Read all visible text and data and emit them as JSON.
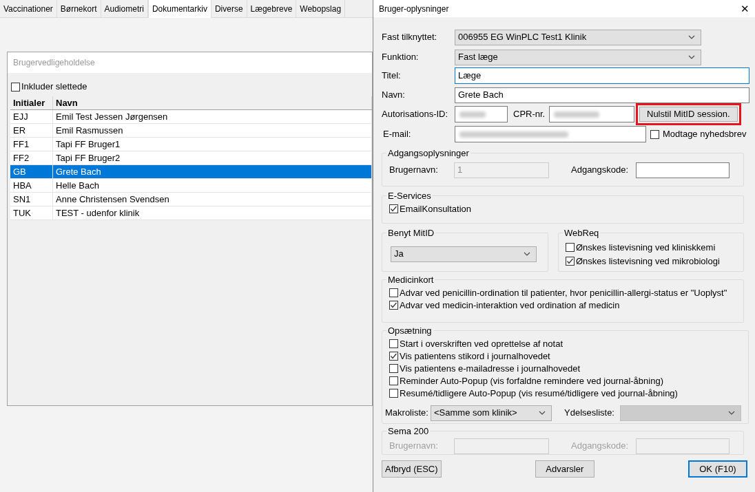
{
  "tabs": [
    {
      "label": "Vaccinationer",
      "selected": false
    },
    {
      "label": "Børnekort",
      "selected": false
    },
    {
      "label": "Audiometri",
      "selected": false
    },
    {
      "label": "Dokumentarkiv",
      "selected": true
    },
    {
      "label": "Diverse",
      "selected": false
    },
    {
      "label": "Lægebreve",
      "selected": false
    },
    {
      "label": "Webopslag",
      "selected": false
    }
  ],
  "panel": {
    "title": "Brugervedligeholdelse",
    "include_deleted": {
      "label": "Inkluder slettede",
      "checked": false
    },
    "table": {
      "columns": [
        "Initialer",
        "Navn"
      ],
      "rows": [
        {
          "cells": [
            "EJJ",
            "Emil Test Jessen Jørgensen"
          ],
          "selected": false
        },
        {
          "cells": [
            "ER",
            "Emil Rasmussen"
          ],
          "selected": false
        },
        {
          "cells": [
            "FF1",
            "Tapi FF Bruger1"
          ],
          "selected": false
        },
        {
          "cells": [
            "FF2",
            "Tapi FF Bruger2"
          ],
          "selected": false
        },
        {
          "cells": [
            "GB",
            "Grete Bach"
          ],
          "selected": true
        },
        {
          "cells": [
            "HBA",
            "Helle Bach"
          ],
          "selected": false
        },
        {
          "cells": [
            "SN1",
            "Anne Christensen Svendsen"
          ],
          "selected": false
        },
        {
          "cells": [
            "TUK",
            "TEST - udenfor klinik"
          ],
          "selected": false
        }
      ]
    }
  },
  "dialog": {
    "title": "Bruger-oplysninger",
    "close": "✕",
    "fast_tilknyttet": {
      "label": "Fast tilknyttet:",
      "value": "006955 EG WinPLC Test1 Klinik"
    },
    "funktion": {
      "label": "Funktion:",
      "value": "Fast læge"
    },
    "titel": {
      "label": "Titel:",
      "value": "Læge",
      "focused": true
    },
    "navn": {
      "label": "Navn:",
      "value": "Grete Bach",
      "focused": false
    },
    "autorisations_id": {
      "label": "Autorisations-ID:"
    },
    "cpr": {
      "label": "CPR-nr."
    },
    "reset_button": {
      "label": "Nulstil MitID session.",
      "highlighted": true
    },
    "email": {
      "label": "E-mail:"
    },
    "newsletter": {
      "label": "Modtage nyhedsbrev",
      "checked": false
    },
    "access": {
      "title": "Adgangsoplysninger",
      "username_label": "Brugernavn:",
      "username_value": "1",
      "username_disabled": true,
      "password_label": "Adgangskode:"
    },
    "eservices": {
      "title": "E-Services",
      "options": [
        {
          "label": "EmailKonsultation",
          "checked": true
        }
      ]
    },
    "mitid": {
      "title": "Benyt MitID",
      "value": "Ja"
    },
    "webreq": {
      "title": "WebReq",
      "options": [
        {
          "label": "Ønskes listevisning ved kliniskkemi",
          "checked": false
        },
        {
          "label": "Ønskes listevisning ved mikrobiologi",
          "checked": true
        }
      ]
    },
    "medicinkort": {
      "title": "Medicinkort",
      "options": [
        {
          "label": "Advar ved penicillin-ordination til patienter, hvor penicillin-allergi-status er \"Uoplyst\"",
          "checked": false
        },
        {
          "label": "Advar ved medicin-interaktion ved ordination af medicin",
          "checked": true
        }
      ]
    },
    "opsaetning": {
      "title": "Opsætning",
      "options": [
        {
          "label": "Start i overskriften ved oprettelse af notat",
          "checked": false
        },
        {
          "label": "Vis patientens stikord i journalhovedet",
          "checked": true
        },
        {
          "label": "Vis patientens e-mailadresse i journalhovedet",
          "checked": false
        },
        {
          "label": "Reminder Auto-Popup (vis forfaldne remindere ved journal-åbning)",
          "checked": false
        },
        {
          "label": "Resumé/tidligere Auto-Popup (vis resumé/tidligere ved journal-åbning)",
          "checked": false
        }
      ],
      "makroliste": {
        "label": "Makroliste:",
        "value": "<Samme som klinik>"
      },
      "ydelsesliste": {
        "label": "Ydelsesliste:",
        "disabled": true
      }
    },
    "sema": {
      "title": "Sema 200",
      "username_label": "Brugernavn:",
      "password_label": "Adgangskode:",
      "disabled": true
    },
    "buttons": [
      {
        "label": "Afbryd (ESC)",
        "default": false
      },
      {
        "label": "Advarsler",
        "default": false
      },
      {
        "label": "OK (F10)",
        "default": true
      }
    ]
  }
}
